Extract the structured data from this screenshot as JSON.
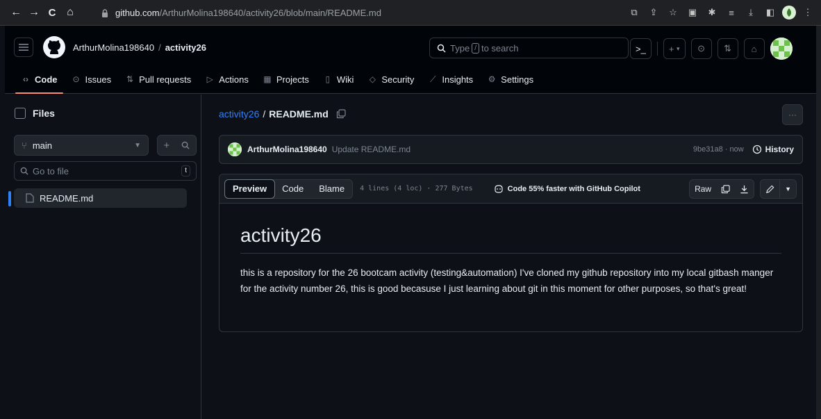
{
  "browser": {
    "url_host": "github.com",
    "url_path": "/ArthurMolina198640/activity26/blob/main/README.md",
    "nav": {
      "back": "←",
      "forward": "→",
      "reload": "C",
      "home": "⌂"
    }
  },
  "header": {
    "owner": "ArthurMolina198640",
    "separator": "/",
    "repo": "activity26",
    "search_prefix": "Type",
    "search_key": "/",
    "search_suffix": "to search",
    "plus": "+",
    "plus_caret": "▾"
  },
  "tabs": [
    {
      "label": "Code",
      "icon": "‹›"
    },
    {
      "label": "Issues",
      "icon": "⊙"
    },
    {
      "label": "Pull requests",
      "icon": "⇅"
    },
    {
      "label": "Actions",
      "icon": "▷"
    },
    {
      "label": "Projects",
      "icon": "▦"
    },
    {
      "label": "Wiki",
      "icon": "▯"
    },
    {
      "label": "Security",
      "icon": "◇"
    },
    {
      "label": "Insights",
      "icon": "⟋"
    },
    {
      "label": "Settings",
      "icon": "⚙"
    }
  ],
  "sidebar": {
    "title": "Files",
    "branch": "main",
    "goto_placeholder": "Go to file",
    "goto_key": "t",
    "files": [
      "README.md"
    ]
  },
  "file": {
    "repo_link": "activity26",
    "separator": "/",
    "name": "README.md",
    "more": "···"
  },
  "commit": {
    "author": "ArthurMolina198640",
    "message": "Update README.md",
    "meta": "9be31a8 · now",
    "history": "History"
  },
  "viewer": {
    "tabs": [
      "Preview",
      "Code",
      "Blame"
    ],
    "info": "4 lines (4 loc) · 277 Bytes",
    "copilot": "Code 55% faster with GitHub Copilot",
    "raw": "Raw"
  },
  "readme": {
    "heading": "activity26",
    "body": "this is a repository for the 26 bootcam activity (testing&automation) I've cloned my github repository into my local gitbash manger for the activity number 26, this is good becasuse I just learning about git in this moment for other purposes, so that's great!"
  },
  "colors": {
    "accent": "#2f81f7",
    "tab_underline": "#fd8c73",
    "bg": "#0d1117"
  }
}
